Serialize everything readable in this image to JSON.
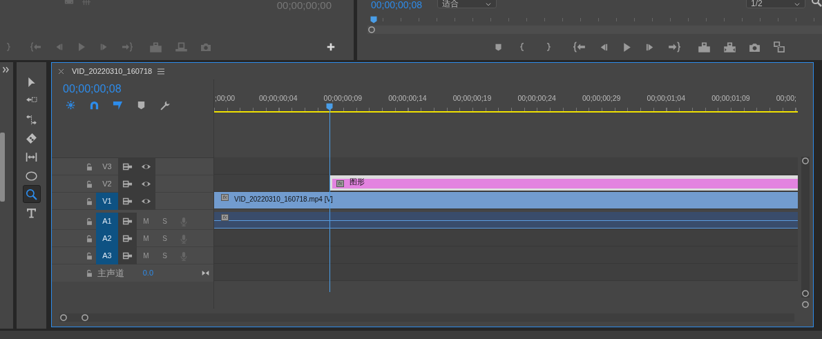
{
  "source_monitor": {
    "timecode": "00;00;00;00"
  },
  "program_monitor": {
    "timecode": "00;00;00;08",
    "zoom": "适合",
    "quality": "1/2"
  },
  "tools": [
    {
      "kind": "selection",
      "selected": false
    },
    {
      "kind": "track-select",
      "selected": false
    },
    {
      "kind": "ripple",
      "selected": false
    },
    {
      "kind": "razor",
      "selected": false
    },
    {
      "kind": "slip",
      "selected": false
    },
    {
      "kind": "ellipse",
      "selected": false
    },
    {
      "kind": "zoom",
      "selected": true
    },
    {
      "kind": "type",
      "selected": false
    }
  ],
  "timeline": {
    "title": "VID_20220310_160718",
    "timecode": "00;00;00;08",
    "toggles": [
      {
        "kind": "nest",
        "on": true
      },
      {
        "kind": "snap",
        "on": true
      },
      {
        "kind": "linked",
        "on": true
      },
      {
        "kind": "marker",
        "on": false
      },
      {
        "kind": "settings",
        "on": false
      }
    ],
    "ruler_labels": [
      ";00;00",
      "00;00;00;04",
      "00;00;00;09",
      "00;00;00;14",
      "00;00;00;19",
      "00;00;00;24",
      "00;00;00;29",
      "00;00;01;04",
      "00;00;01;09",
      "00;00;"
    ],
    "tracks": [
      {
        "name": "V3",
        "kind": "video",
        "targeted": false
      },
      {
        "name": "V2",
        "kind": "video",
        "targeted": false,
        "clip": {
          "kind": "graphic",
          "fx": "fx",
          "label": "图形",
          "color": "#e383e0"
        }
      },
      {
        "name": "V1",
        "kind": "video",
        "targeted": true,
        "clip": {
          "kind": "video",
          "fx": "fx",
          "label": "VID_20220310_160718.mp4 [V]",
          "color": "#729ccf"
        }
      },
      {
        "name": "A1",
        "kind": "audio",
        "targeted": true,
        "mute": "M",
        "solo": "S",
        "clip": {
          "kind": "audio",
          "fx": "fx",
          "color": "#394c6b"
        }
      },
      {
        "name": "A2",
        "kind": "audio",
        "targeted": true,
        "mute": "M",
        "solo": "S"
      },
      {
        "name": "A3",
        "kind": "audio",
        "targeted": true,
        "mute": "M",
        "solo": "S"
      }
    ],
    "master": {
      "name": "主声道",
      "volume": "0.0"
    }
  }
}
